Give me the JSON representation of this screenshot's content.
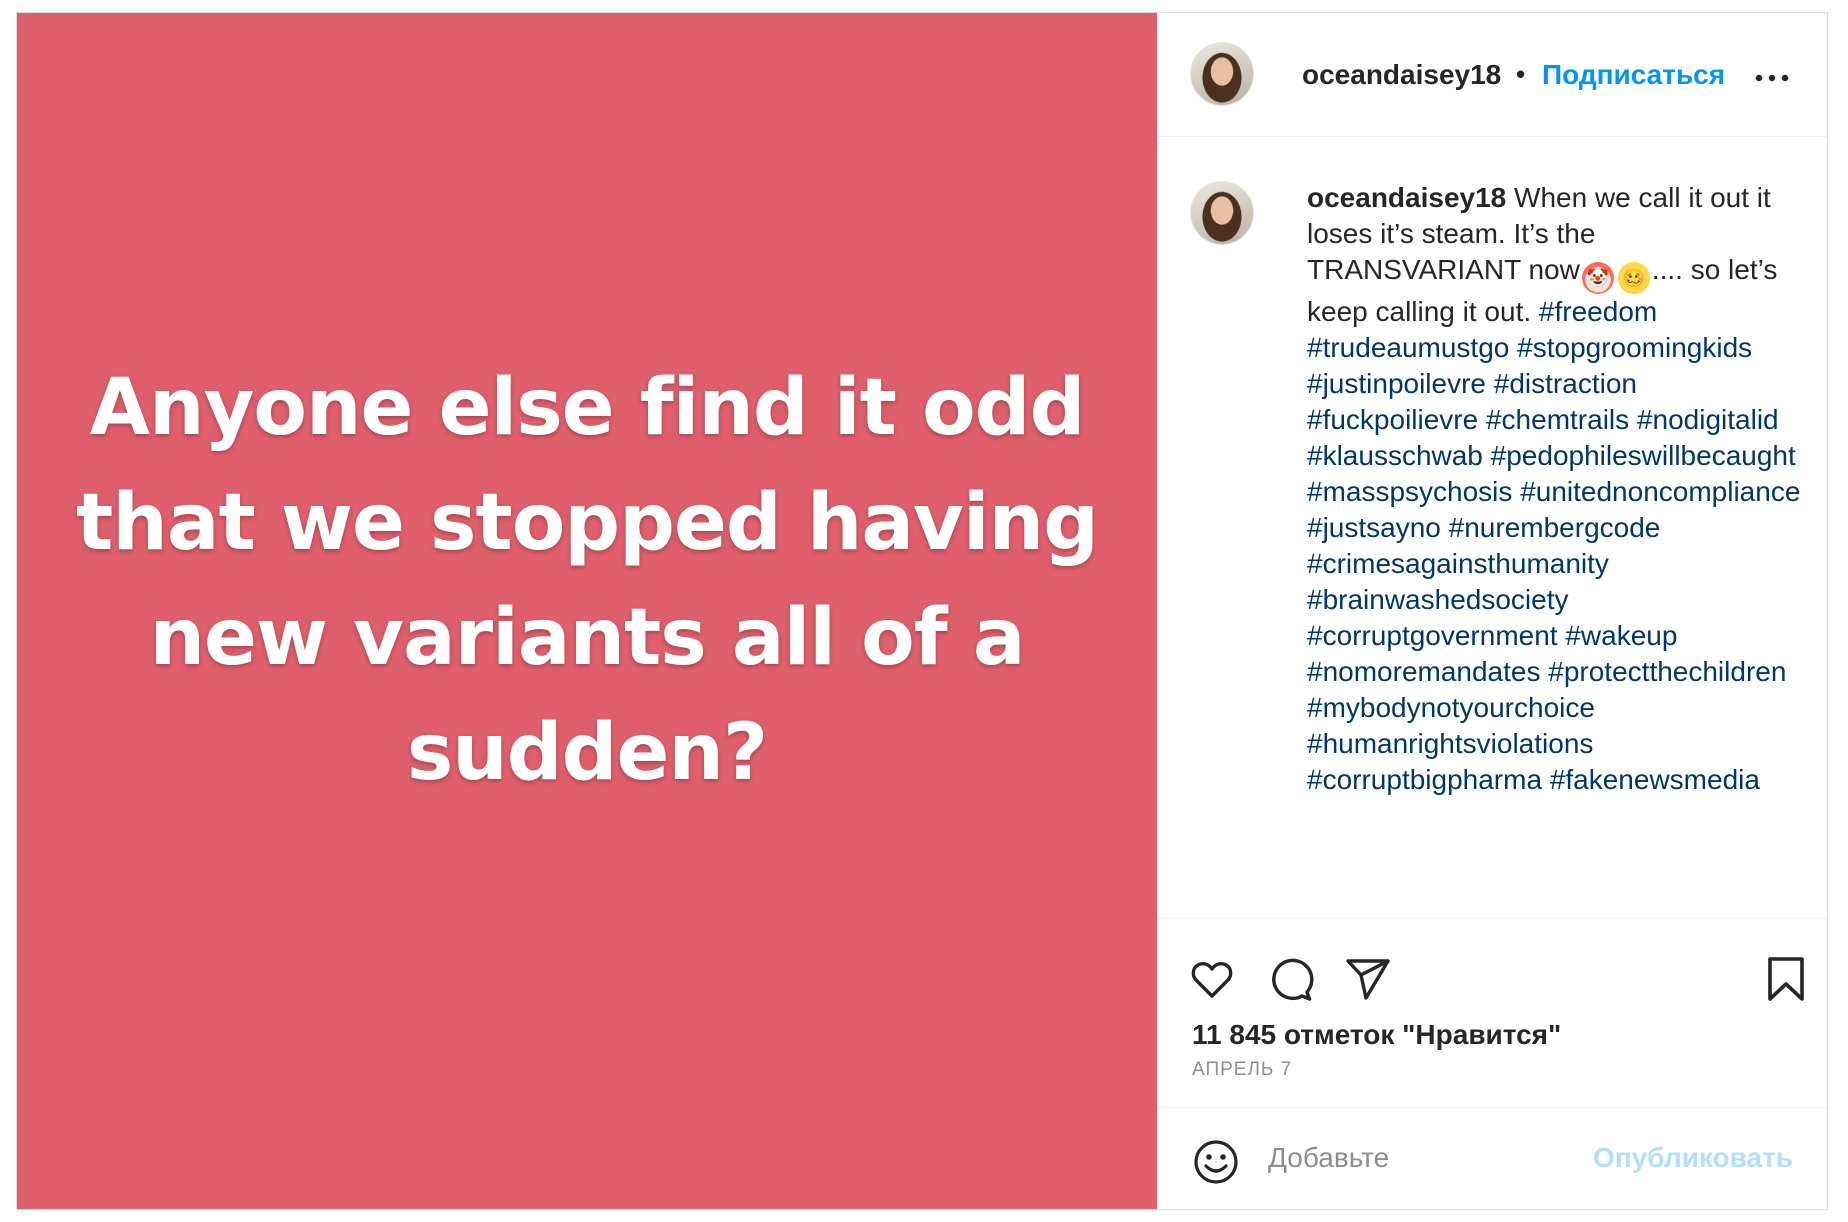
{
  "colors": {
    "media_background": "#e05f6c",
    "link_blue": "#0095f6",
    "hashtag": "#00376b",
    "publish_disabled": "#b2dffc"
  },
  "media": {
    "text": "Anyone else find it odd that we stopped having new variants all of a sudden?"
  },
  "header": {
    "username": "oceandaisey18",
    "separator": "•",
    "follow_label": "Подписаться",
    "more_icon": "more-horizontal-icon"
  },
  "caption": {
    "username": "oceandaisey18",
    "text_part1": "When we call it out it loses it’s steam. It’s the TRANSVARIANT now",
    "emoji_1": "clown-face",
    "emoji_2": "woozy-face",
    "text_part2": ".... so let’s keep calling it out. ",
    "hashtags": [
      "#freedom",
      "#trudeaumustgo",
      "#stopgroomingkids",
      "#justinpoilevre",
      "#distraction",
      "#fuckpoilievre",
      "#chemtrails",
      "#nodigitalid",
      "#klausschwab",
      "#pedophileswillbecaught",
      "#masspsychosis",
      "#unitednoncompliance",
      "#justsayno",
      "#nurembergcode",
      "#crimesagainsthumanity",
      "#brainwashedsociety",
      "#corruptgovernment",
      "#wakeup",
      "#nomoremandates",
      "#protectthechildren",
      "#mybodynotyourchoice",
      "#humanrightsviolations",
      "#corruptbigpharma",
      "#fakenewsmedia"
    ]
  },
  "actions": {
    "like_icon": "heart-icon",
    "comment_icon": "comment-icon",
    "share_icon": "share-icon",
    "save_icon": "bookmark-icon"
  },
  "likes_text": "11 845 отметок \"Нравится\"",
  "date_text": "АПРЕЛЬ 7",
  "comment": {
    "emoji_icon": "smile-icon",
    "placeholder": "Добавьте",
    "publish_label": "Опубликовать"
  }
}
